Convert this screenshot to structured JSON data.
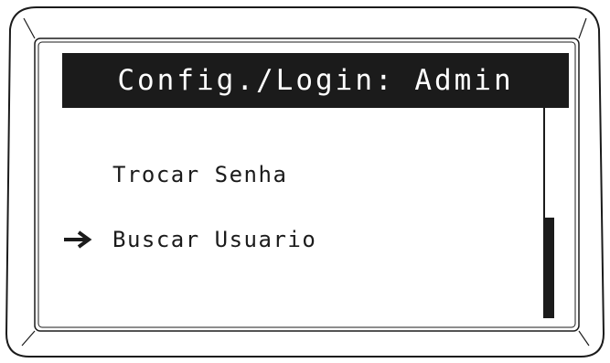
{
  "screen": {
    "title": "Config./Login: Admin",
    "menu": {
      "items": [
        {
          "label": "Trocar Senha",
          "selected": false
        },
        {
          "label": "Buscar Usuario",
          "selected": true
        }
      ],
      "selected_index": 1,
      "selection_indicator": "right-arrow-icon"
    },
    "scroll": {
      "thumb_start_fraction": 0.52,
      "thumb_end_fraction": 1.0
    }
  },
  "colors": {
    "ink": "#1b1b1b",
    "background": "#ffffff",
    "title_text": "#ffffff"
  }
}
